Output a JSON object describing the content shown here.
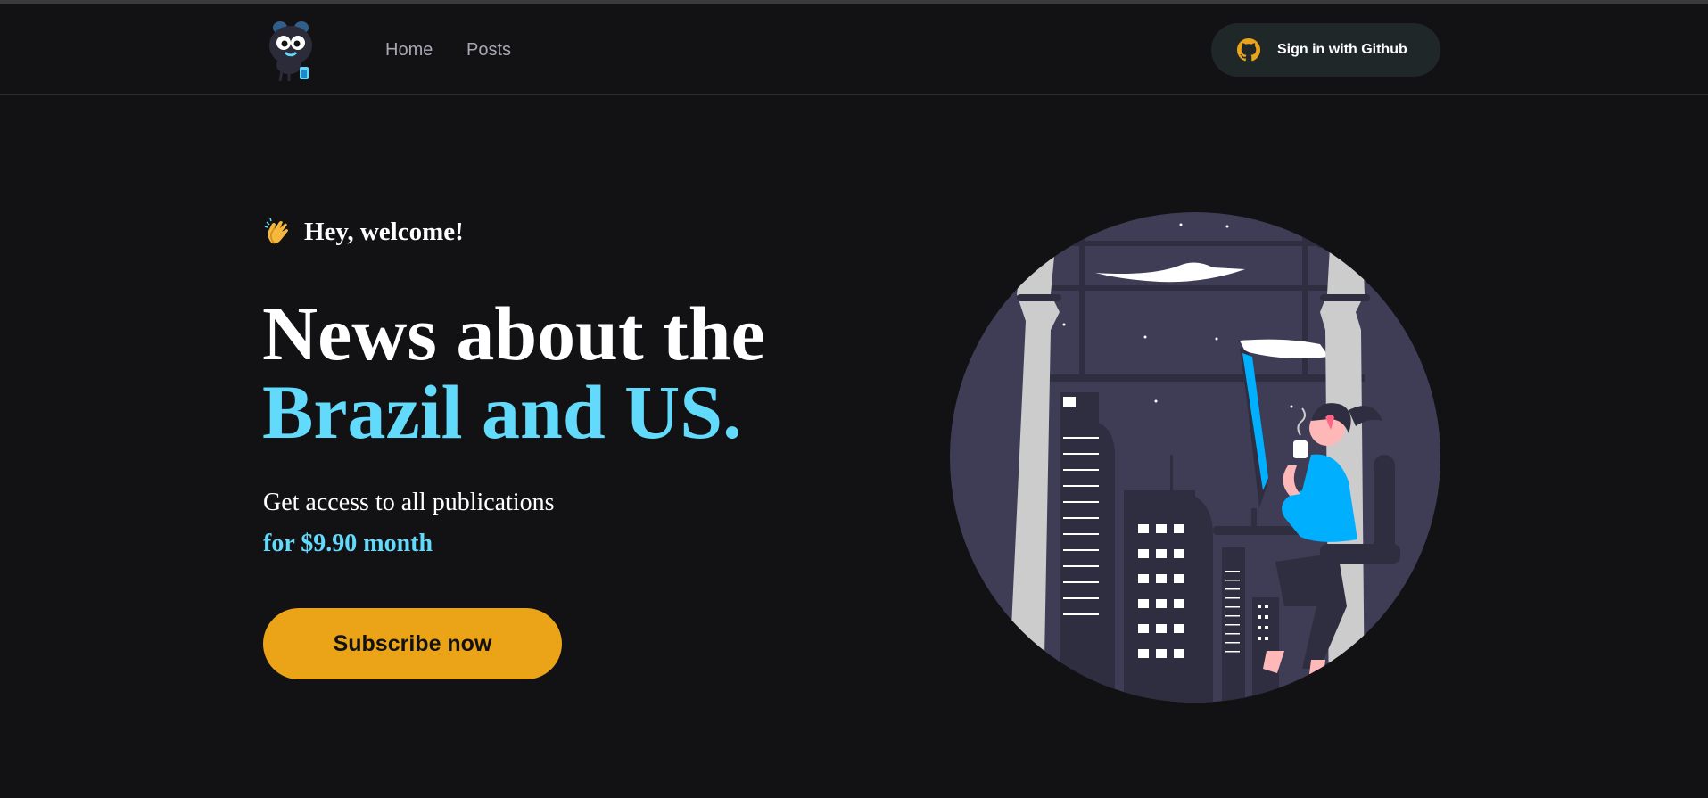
{
  "nav": {
    "home_label": "Home",
    "posts_label": "Posts",
    "signin_label": "Sign in with Github"
  },
  "hero": {
    "welcome": "Hey, welcome!",
    "headline_line1": "News about the",
    "headline_line2": "Brazil and US.",
    "subtitle": "Get access to all publications",
    "price_line": "for $9.90 month",
    "subscribe_label": "Subscribe now"
  },
  "colors": {
    "background": "#121214",
    "accent_blue": "#61dafb",
    "cta_yellow": "#eba417",
    "header_button_bg": "#1f2729",
    "nav_text": "#a8a8b3"
  },
  "icons": [
    "logo-mascot-icon",
    "github-icon",
    "clapping-hands-icon",
    "hero-illustration"
  ]
}
